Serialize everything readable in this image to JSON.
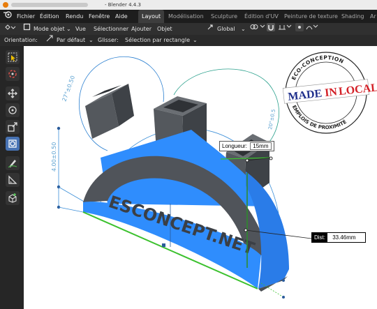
{
  "window": {
    "title": "- Blender 4.4.3"
  },
  "menu": [
    "Fichier",
    "Édition",
    "Rendu",
    "Fenêtre",
    "Aide"
  ],
  "workspaces": [
    "Layout",
    "Modélisation",
    "Sculpture",
    "Édition d'UV",
    "Peinture de texture",
    "Shading",
    "Ar"
  ],
  "active_workspace": "Layout",
  "toolbar": {
    "mode": "Mode objet",
    "items": [
      "Vue",
      "Sélectionner",
      "Ajouter",
      "Objet"
    ],
    "orientation": "Global"
  },
  "options": {
    "orientation_label": "Orientation:",
    "orientation_value": "Par défaut",
    "drag_label": "Glisser:",
    "drag_value": "Sélection par rectangle"
  },
  "tools": [
    "select-box-icon",
    "cursor-icon",
    "move-icon",
    "rotate-icon",
    "scale-icon",
    "transform-icon",
    "annotate-icon",
    "measure-icon",
    "add-cube-icon"
  ],
  "badge": {
    "top_text": "ECO-CONCEPTION",
    "main_left": "MADE",
    "main_mid": "IN",
    "main_right": "LOCAL",
    "bottom_text": "EMPLOIS DE PROXIMITÉ"
  },
  "model": {
    "engraving": "ESCONCEPT.NET",
    "dim_height": "4.00±0.50",
    "dim_arc_left": "27°±0.50",
    "dim_arc_right": "20°±0.5"
  },
  "callouts": {
    "longueur_label": "Longueur:",
    "longueur_value": "15mm",
    "dist_label": "Dist:",
    "dist_value": "33.46mm"
  },
  "colors": {
    "accent": "#4772b3",
    "model_blue": "#2f8dfd",
    "model_dark": "#4a4e53",
    "edge_green": "#3cc12e",
    "badge_red": "#d31f26",
    "badge_blue": "#1f2f8c"
  }
}
